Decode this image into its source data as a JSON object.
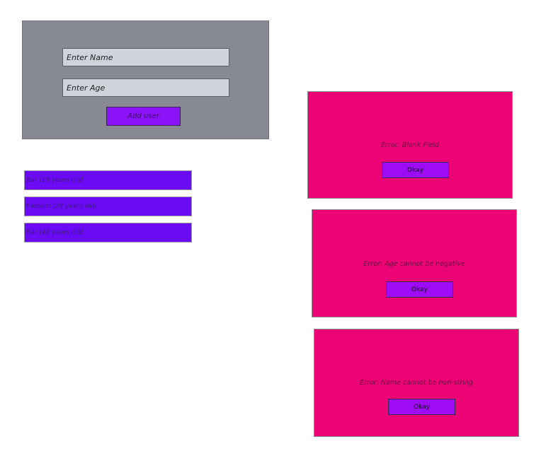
{
  "form": {
    "name_placeholder": "Enter Name",
    "age_placeholder": "Enter Age",
    "add_button_label": "Add user"
  },
  "users": [
    {
      "label": "Bar (19 years old)"
    },
    {
      "label": "Fassam (28 years old)"
    },
    {
      "label": "Bar (42 years old)"
    }
  ],
  "errors": [
    {
      "message": "Error: Blank Field",
      "button_label": "Okay"
    },
    {
      "message": "Error: Age cannot be negative",
      "button_label": "Okay"
    },
    {
      "message": "Error: Name cannot be non-string",
      "button_label": "Okay"
    }
  ],
  "colors": {
    "panel": "#878a93",
    "input": "#cfd3dc",
    "button": "#8c12f7",
    "list_item": "#6b0bf6",
    "modal": "#ec0477"
  }
}
